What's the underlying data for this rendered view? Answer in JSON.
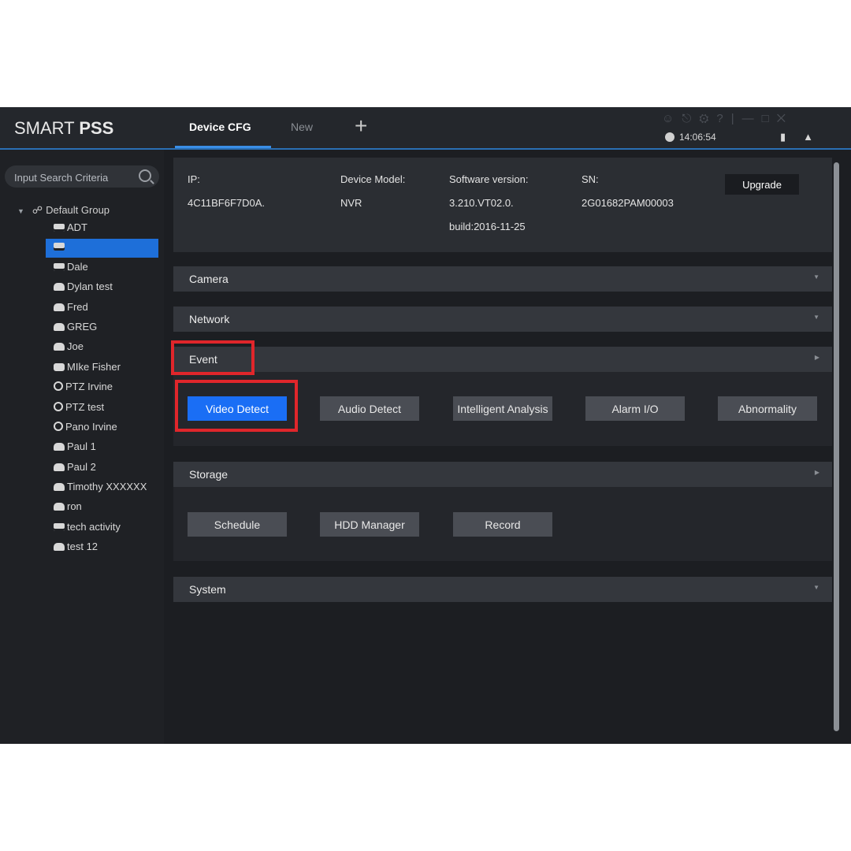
{
  "app": {
    "logo_light": "SMART ",
    "logo_bold": "PSS",
    "tabs": [
      {
        "label": "Device CFG"
      },
      {
        "label": "New"
      }
    ],
    "add_tab_glyph": "+",
    "clock": "14:06:54",
    "system_icons": [
      "user-icon",
      "lock-icon",
      "gear-icon",
      "help-icon",
      "minimize-icon",
      "maximize-icon",
      "close-icon"
    ],
    "tray_icons": [
      "device-icon",
      "bell-icon"
    ]
  },
  "sidebar": {
    "search_placeholder": "Input Search Criteria",
    "group_label": "Default Group",
    "devices": [
      {
        "label": "ADT",
        "icon": "nvr"
      },
      {
        "label": "",
        "icon": "nvr",
        "selected": true
      },
      {
        "label": "Dale",
        "icon": "nvr"
      },
      {
        "label": "Dylan test",
        "icon": "dvr"
      },
      {
        "label": "Fred",
        "icon": "dvr"
      },
      {
        "label": "GREG",
        "icon": "dvr"
      },
      {
        "label": "Joe",
        "icon": "dvr"
      },
      {
        "label": "MIke Fisher",
        "icon": "cam"
      },
      {
        "label": "PTZ Irvine",
        "icon": "ptz"
      },
      {
        "label": "PTZ test",
        "icon": "ptz"
      },
      {
        "label": "Pano Irvine",
        "icon": "ptz"
      },
      {
        "label": "Paul 1",
        "icon": "dvr"
      },
      {
        "label": "Paul 2",
        "icon": "dvr"
      },
      {
        "label": "Timothy  XXXXXX",
        "icon": "dvr"
      },
      {
        "label": "ron",
        "icon": "dvr"
      },
      {
        "label": "tech activity",
        "icon": "nvr"
      },
      {
        "label": "test 12",
        "icon": "dvr"
      }
    ]
  },
  "device_info": {
    "ip_label": "IP:",
    "ip_value": "4C11BF6F7D0A.",
    "model_label": "Device Model:",
    "model_value": "NVR",
    "software_label": "Software version:",
    "software_value_1": "3.210.VT02.0.",
    "software_value_2": "build:2016-11-25",
    "sn_label": "SN:",
    "sn_value": "2G01682PAM00003",
    "upgrade_label": "Upgrade"
  },
  "sections": {
    "camera": "Camera",
    "network": "Network",
    "event": "Event",
    "storage": "Storage",
    "system": "System"
  },
  "event_buttons": [
    "Video Detect",
    "Audio Detect",
    "Intelligent Analysis",
    "Alarm I/O",
    "Abnormality"
  ],
  "storage_buttons": [
    "Schedule",
    "HDD Manager",
    "Record"
  ],
  "colors": {
    "accent": "#1a6ef5",
    "highlight": "#e0262b",
    "background": "#1c1e22"
  }
}
